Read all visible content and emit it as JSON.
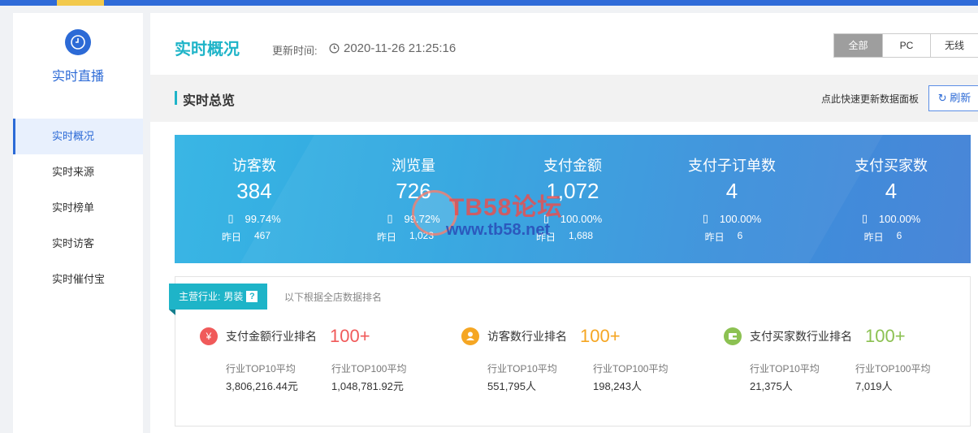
{
  "sidebar": {
    "title": "实时直播",
    "items": [
      {
        "label": "实时概况",
        "active": true
      },
      {
        "label": "实时来源"
      },
      {
        "label": "实时榜单"
      },
      {
        "label": "实时访客"
      },
      {
        "label": "实时催付宝"
      }
    ]
  },
  "header": {
    "title": "实时概况",
    "update_label": "更新时间:",
    "update_time": "2020-11-26 21:25:16",
    "segments": [
      "全部",
      "PC",
      "无线"
    ],
    "selected_segment": "全部"
  },
  "overview": {
    "title": "实时总览",
    "hint": "点此快速更新数据面板",
    "refresh_label": "刷新"
  },
  "stats": [
    {
      "label": "访客数",
      "value": "384",
      "share": "99.74%",
      "yesterday_label": "昨日",
      "yesterday": "467"
    },
    {
      "label": "浏览量",
      "value": "726",
      "share": "99.72%",
      "yesterday_label": "昨日",
      "yesterday": "1,023"
    },
    {
      "label": "支付金额",
      "value": "1,072",
      "share": "100.00%",
      "yesterday_label": "昨日",
      "yesterday": "1,688"
    },
    {
      "label": "支付子订单数",
      "value": "4",
      "share": "100.00%",
      "yesterday_label": "昨日",
      "yesterday": "6"
    },
    {
      "label": "支付买家数",
      "value": "4",
      "share": "100.00%",
      "yesterday_label": "昨日",
      "yesterday": "6"
    }
  ],
  "watermark": {
    "line1": "TB58论坛",
    "line2": "www.tb58.net"
  },
  "ranking": {
    "industry_label": "主营行业:",
    "industry": "男装",
    "help": "?",
    "note": "以下根据全店数据排名",
    "items": [
      {
        "icon": "yen-icon",
        "color": "#f05a5a",
        "name": "支付金额行业排名",
        "rank": "100+",
        "top10_label": "行业TOP10平均",
        "top10": "3,806,216.44元",
        "top100_label": "行业TOP100平均",
        "top100": "1,048,781.92元"
      },
      {
        "icon": "user-icon",
        "color": "#f5a623",
        "name": "访客数行业排名",
        "rank": "100+",
        "top10_label": "行业TOP10平均",
        "top10": "551,795人",
        "top100_label": "行业TOP100平均",
        "top100": "198,243人"
      },
      {
        "icon": "wallet-icon",
        "color": "#8cc152",
        "name": "支付买家数行业排名",
        "rank": "100+",
        "top10_label": "行业TOP10平均",
        "top10": "21,375人",
        "top100_label": "行业TOP100平均",
        "top100": "7,019人"
      }
    ]
  }
}
